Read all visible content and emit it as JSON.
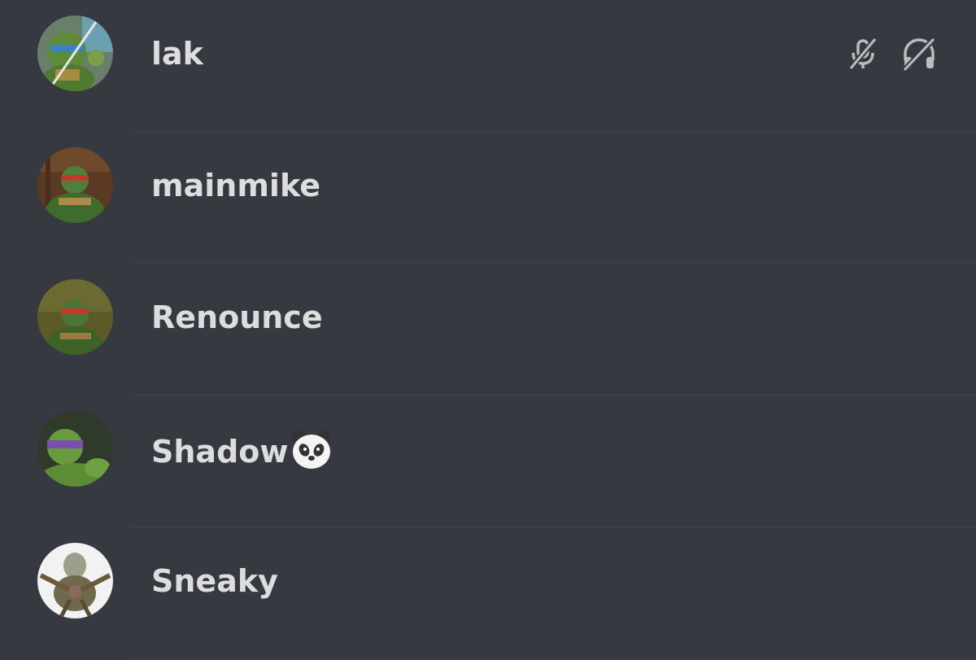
{
  "voice_channel": {
    "members": [
      {
        "name": "lak",
        "avatar": "leonardo-avatar",
        "status_icons": [
          "mic-muted-icon",
          "headset-deafened-icon"
        ]
      },
      {
        "name": "mainmike",
        "avatar": "raphael-avatar",
        "status_icons": []
      },
      {
        "name": "Renounce",
        "avatar": "raphael-avatar",
        "status_icons": []
      },
      {
        "name": "Shadow",
        "emoji": "panda-face",
        "avatar": "donatello-avatar",
        "status_icons": []
      },
      {
        "name": "Sneaky",
        "avatar": "krang-avatar",
        "status_icons": []
      }
    ]
  },
  "colors": {
    "background": "#36393f",
    "separator": "#41444a",
    "username_text": "#dcddde",
    "status_icon": "#b9bbbe"
  }
}
